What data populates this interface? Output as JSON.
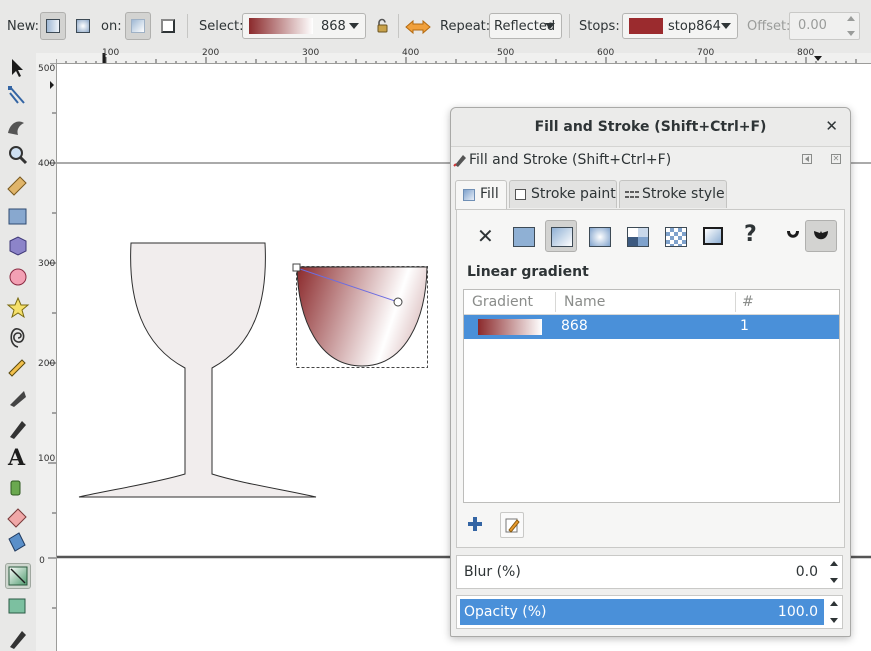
{
  "toolbar": {
    "new_label": "New:",
    "on_label": "on:",
    "select_label": "Select:",
    "select_value": "868",
    "repeat_label": "Repeat:",
    "repeat_value": "Reflected",
    "stops_label": "Stops:",
    "stops_value": "stop864",
    "offset_label": "Offset:",
    "offset_value": "0.00"
  },
  "ruler": {
    "top_ticks": [
      "100",
      "200",
      "300",
      "400",
      "500",
      "600",
      "700",
      "800"
    ],
    "left_ticks": [
      "500",
      "400",
      "300",
      "200",
      "100",
      "0"
    ]
  },
  "dialog": {
    "title": "Fill and Stroke (Shift+Ctrl+F)",
    "close_glyph": "✕",
    "dock_title": "Fill and Stroke (Shift+Ctrl+F)",
    "tabs": [
      {
        "label": "Fill"
      },
      {
        "label": "Stroke paint"
      },
      {
        "label": "Stroke style"
      }
    ],
    "paint_type_label": "Linear gradient",
    "unset_glyph": "?",
    "none_glyph": "✕",
    "gradient_list": {
      "columns": [
        "Gradient",
        "Name",
        "#"
      ],
      "rows": [
        {
          "name": "868",
          "count": "1"
        }
      ]
    },
    "blur_label": "Blur (%)",
    "blur_value": "0.0",
    "opacity_label": "Opacity (%)",
    "opacity_value": "100.0"
  },
  "colors": {
    "accent": "#4a90d9",
    "stop_color": "#9b2b2e",
    "gradient_start": "#8b2a2c",
    "gradient_end": "#ffffff",
    "glass_fill": "#f1eded"
  }
}
